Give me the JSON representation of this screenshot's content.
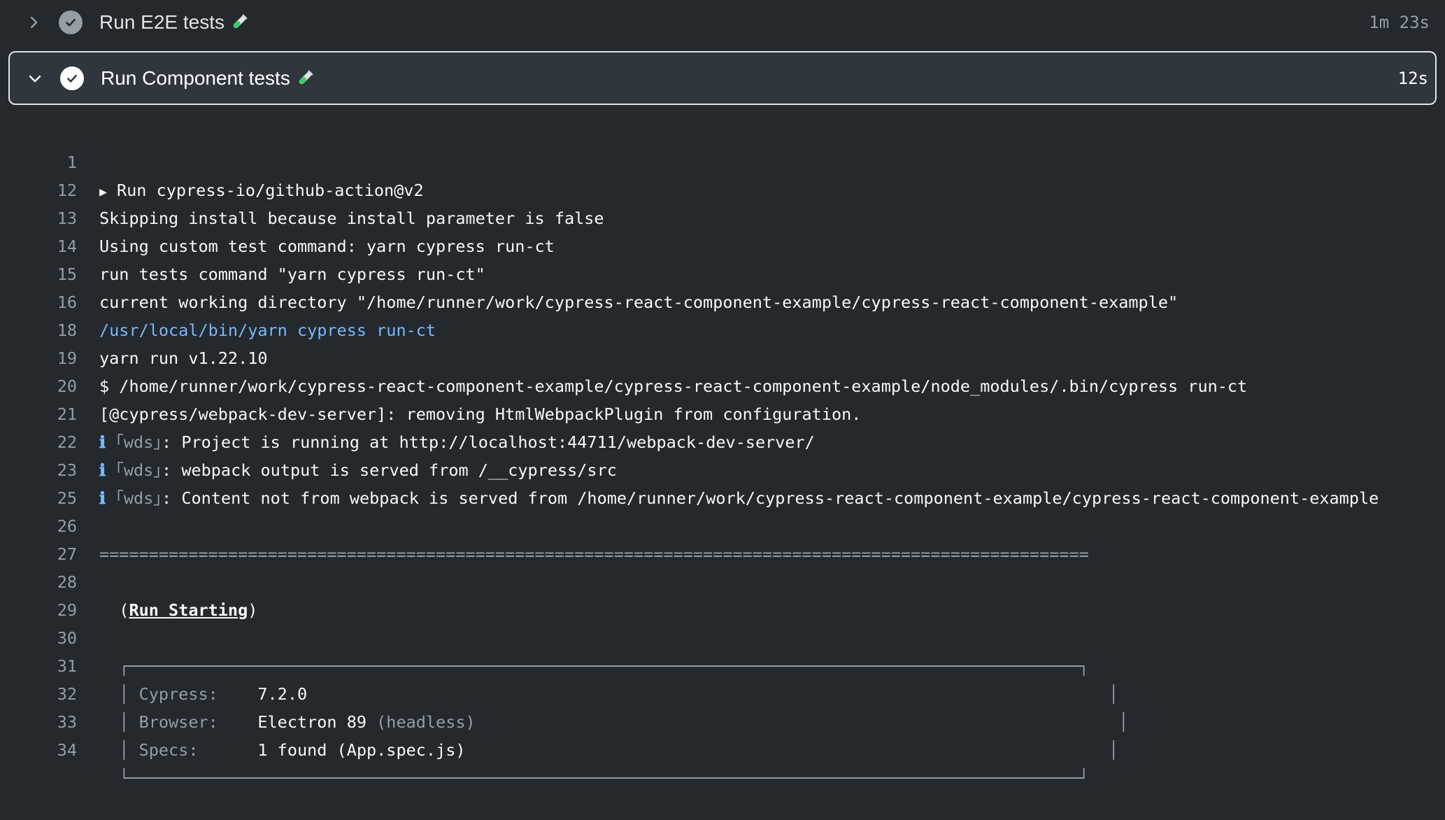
{
  "steps": [
    {
      "title": "Run E2E tests",
      "time": "1m 23s",
      "expanded": false
    },
    {
      "title": "Run Component tests",
      "time": "12s",
      "expanded": true
    }
  ],
  "icons": {
    "chevron_collapsed": "chevron-right-icon",
    "chevron_expanded": "chevron-down-icon",
    "status": "check-circle-icon",
    "emoji": "test-tube-icon"
  },
  "colors": {
    "background": "#24292e",
    "header_bg": "#2f363d",
    "link_blue": "#79b8ff",
    "muted": "#959da5"
  },
  "log": [
    {
      "n": "1",
      "text": "Run cypress-io/github-action@v2"
    },
    {
      "n": "12",
      "text": "Skipping install because install parameter is false"
    },
    {
      "n": "13",
      "text": "Using custom test command: yarn cypress run-ct"
    },
    {
      "n": "14",
      "text": "run tests command \"yarn cypress run-ct\""
    },
    {
      "n": "15",
      "text": "current working directory \"/home/runner/work/cypress-react-component-example/cypress-react-component-example\""
    },
    {
      "n": "16",
      "text": "/usr/local/bin/yarn cypress run-ct"
    },
    {
      "n": "18",
      "text": "yarn run v1.22.10"
    },
    {
      "n": "19",
      "text": "$ /home/runner/work/cypress-react-component-example/cypress-react-component-example/node_modules/.bin/cypress run-ct"
    },
    {
      "n": "20",
      "text": "[@cypress/webpack-dev-server]: removing HtmlWebpackPlugin from configuration."
    },
    {
      "n": "21",
      "prefix": "ℹ",
      "tag": "｢wds｣",
      "text": ": Project is running at http://localhost:44711/webpack-dev-server/"
    },
    {
      "n": "22",
      "prefix": "ℹ",
      "tag": "｢wds｣",
      "text": ": webpack output is served from /__cypress/src"
    },
    {
      "n": "23",
      "prefix": "ℹ",
      "tag": "｢wds｣",
      "text": ": Content not from webpack is served from /home/runner/work/cypress-react-component-example/cypress-react-component-example"
    },
    {
      "n": "25",
      "text": ""
    },
    {
      "n": "26",
      "text": "===================================================================================================="
    },
    {
      "n": "27",
      "text": ""
    },
    {
      "n": "28",
      "open": "  (",
      "label": "Run Starting",
      "close": ")"
    },
    {
      "n": "29",
      "text": ""
    },
    {
      "n": "30",
      "text": "  ┌────────────────────────────────────────────────────────────────────────────────────────────────┐"
    },
    {
      "n": "31",
      "bar": "  │ ",
      "key": "Cypress:    ",
      "val": "7.2.0",
      "extra": "",
      "pad": "                                                                                 │"
    },
    {
      "n": "32",
      "bar": "  │ ",
      "key": "Browser:    ",
      "val": "Electron 89 ",
      "extra": "(headless)",
      "pad": "                                                                 │"
    },
    {
      "n": "33",
      "bar": "  │ ",
      "key": "Specs:      ",
      "val": "1 found (App.spec.js)",
      "extra": "",
      "pad": "                                                                 │"
    },
    {
      "n": "34",
      "text": "  └────────────────────────────────────────────────────────────────────────────────────────────────┘"
    }
  ]
}
